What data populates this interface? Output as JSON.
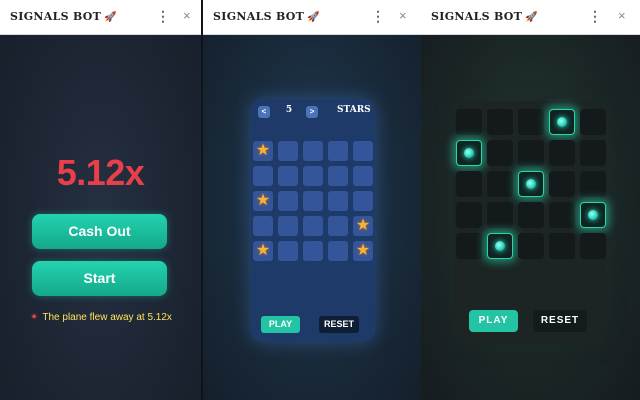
{
  "windows": [
    {
      "title": "SIGNALS BOT",
      "rocket_glyph": "🚀",
      "more_glyph": "⋮",
      "close_glyph": "×"
    },
    {
      "title": "SIGNALS BOT",
      "rocket_glyph": "🚀",
      "more_glyph": "⋮",
      "close_glyph": "×"
    },
    {
      "title": "SIGNALS BOT",
      "rocket_glyph": "🚀",
      "more_glyph": "⋮",
      "close_glyph": "×"
    }
  ],
  "aviator": {
    "multiplier": "5.12x",
    "cash_out_label": "Cash Out",
    "start_label": "Start",
    "status_icon": "✴",
    "status_text": "The plane flew away at 5.12x"
  },
  "mines": {
    "prev_glyph": "<",
    "next_glyph": ">",
    "count": "5",
    "mode": "STARS",
    "rows": 5,
    "cols": 5,
    "star_glyph": "★",
    "stars": [
      [
        0,
        0
      ],
      [
        2,
        0
      ],
      [
        3,
        4
      ],
      [
        4,
        0
      ],
      [
        4,
        4
      ]
    ],
    "play_label": "PLAY",
    "reset_label": "RESET"
  },
  "gems": {
    "rows": 5,
    "cols": 5,
    "lit": [
      [
        0,
        3
      ],
      [
        1,
        0
      ],
      [
        2,
        2
      ],
      [
        3,
        4
      ],
      [
        4,
        1
      ]
    ],
    "play_label": "PLAY",
    "reset_label": "RESET"
  },
  "colors": {
    "accent_teal": "#22c4a3",
    "multiplier_red": "#e8404a",
    "status_yellow": "#ffe45c",
    "star_orange": "#f6b33a",
    "mines_board_blue": "#1e3a68"
  }
}
